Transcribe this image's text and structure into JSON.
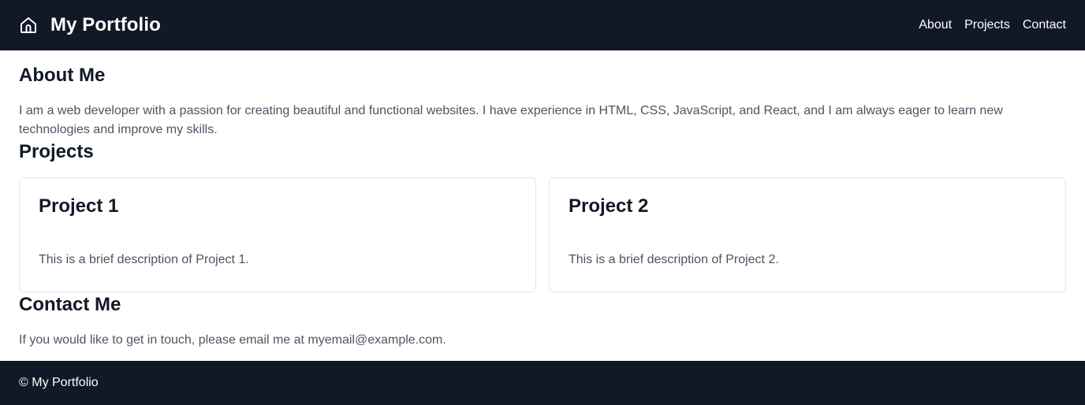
{
  "header": {
    "icon": "home-icon",
    "title": "My Portfolio",
    "nav": [
      {
        "label": "About"
      },
      {
        "label": "Projects"
      },
      {
        "label": "Contact"
      }
    ]
  },
  "about": {
    "heading": "About Me",
    "text": "I am a web developer with a passion for creating beautiful and functional websites. I have experience in HTML, CSS, JavaScript, and React, and I am always eager to learn new technologies and improve my skills."
  },
  "projects": {
    "heading": "Projects",
    "items": [
      {
        "title": "Project 1",
        "description": "This is a brief description of Project 1."
      },
      {
        "title": "Project 2",
        "description": "This is a brief description of Project 2."
      }
    ]
  },
  "contact": {
    "heading": "Contact Me",
    "text": "If you would like to get in touch, please email me at myemail@example.com."
  },
  "footer": {
    "text": "© My Portfolio"
  },
  "colors": {
    "header_bg": "#111827",
    "footer_bg": "#111827",
    "body_text": "#4b5563",
    "heading_text": "#111827",
    "card_border": "#e5e7eb"
  }
}
